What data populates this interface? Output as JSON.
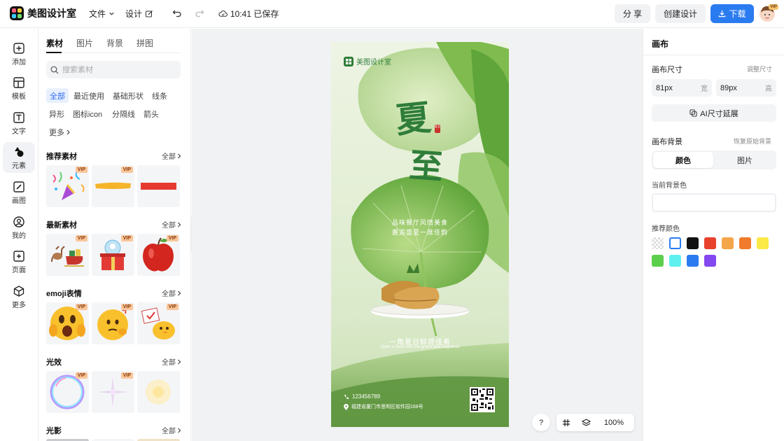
{
  "app": {
    "name": "美图设计室"
  },
  "toolbar": {
    "file": "文件",
    "design": "设计",
    "save_status": "10:41 已保存",
    "share": "分 享",
    "create": "创建设计",
    "download": "下载",
    "avatar_badge": "VIP"
  },
  "rail": [
    {
      "label": "添加",
      "icon": "plus-square-icon"
    },
    {
      "label": "模板",
      "icon": "template-icon"
    },
    {
      "label": "文字",
      "icon": "text-icon"
    },
    {
      "label": "元素",
      "icon": "shapes-icon"
    },
    {
      "label": "画图",
      "icon": "draw-icon"
    },
    {
      "label": "我的",
      "icon": "user-icon"
    },
    {
      "label": "页面",
      "icon": "page-icon"
    },
    {
      "label": "更多",
      "icon": "cube-icon"
    }
  ],
  "panel": {
    "tabs": [
      "素材",
      "图片",
      "背景",
      "拼图"
    ],
    "search_placeholder": "搜索素材",
    "chips": [
      "全部",
      "最近使用",
      "基础形状",
      "线条",
      "异形",
      "图标icon",
      "分隔线",
      "箭头",
      "更多"
    ],
    "all_label": "全部",
    "vip": "VIP",
    "sections": [
      "推荐素材",
      "最新素材",
      "emoji表情",
      "光效",
      "光影"
    ]
  },
  "poster": {
    "brand": "美图设计室",
    "title_char_1": "夏",
    "title_char_2": "至",
    "seal": "夏至",
    "line_1": "品味餐厅风情美食",
    "line_2": "邂逅盛夏一席佳韵",
    "caption_cn": "一角夏日鲜荷佳肴",
    "caption_en": "Open a feast with the grand lake fragrance",
    "phone": "123456789",
    "address": "福建省厦门市思明区软件园168号"
  },
  "right": {
    "title": "画布",
    "size_label": "画布尺寸",
    "adjust_size": "调整尺寸",
    "width_value": "81px",
    "width_unit": "宽",
    "height_value": "89px",
    "height_unit": "高",
    "ai_extend": "AI尺寸延展",
    "bg_label": "画布背景",
    "restore_bg": "恢复原始背景",
    "bg_tab_color": "颜色",
    "bg_tab_image": "图片",
    "current_bg": "当前背景色",
    "recommended": "推荐颜色",
    "colors": [
      "transparent",
      "#ffffff",
      "#111111",
      "#e8412c",
      "#f5a54a",
      "#f07b2c",
      "#fbe946",
      "#5ccf4c",
      "#5ef0ef",
      "#2b7bf0",
      "#8448f0"
    ]
  },
  "bottom": {
    "help": "?",
    "zoom": "100%"
  }
}
